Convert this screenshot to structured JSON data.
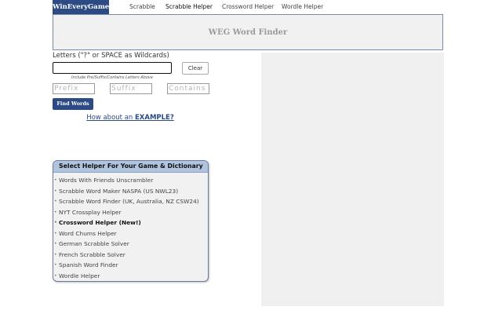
{
  "nav": {
    "brand": "WinEveryGame",
    "links": [
      {
        "label": "Scrabble",
        "active": false
      },
      {
        "label": "Scrabble Helper",
        "active": true
      },
      {
        "label": "Crossword Helper",
        "active": false
      },
      {
        "label": "Wordle Helper",
        "active": false
      }
    ]
  },
  "banner": {
    "title": "WEG Word Finder"
  },
  "form": {
    "letters_label": "Letters (\"?\" or SPACE as Wildcards)",
    "letters_value": "",
    "clear_label": "Clear",
    "hint": "Include Pre/Suffix/Contains Letters Above",
    "prefix_placeholder": "Prefix",
    "suffix_placeholder": "Suffix",
    "contains_placeholder": "Contains",
    "find_label": "Find Words",
    "example_prefix": "How about an ",
    "example_link": "EXAMPLE?"
  },
  "helper": {
    "title": "Select Helper For Your Game & Dictionary",
    "items": [
      {
        "label": "Words With Friends Unscrambler",
        "bold": false
      },
      {
        "label": "Scrabble Word Maker NASPA (US NWL23)",
        "bold": false
      },
      {
        "label": "Scrabble Word Finder (UK, Australia, NZ CSW24)",
        "bold": false
      },
      {
        "label": "NYT Crossplay Helper",
        "bold": false
      },
      {
        "label": "Crossword Helper (New!)",
        "bold": true
      },
      {
        "label": "Word Chums Helper",
        "bold": false
      },
      {
        "label": "German Scrabble Solver",
        "bold": false
      },
      {
        "label": "French Scrabble Solver",
        "bold": false
      },
      {
        "label": "Spanish Word Finder",
        "bold": false
      },
      {
        "label": "Wordle Helper",
        "bold": false
      }
    ]
  },
  "colors": {
    "brand": "#2c4a84",
    "helper_header": "#b0c4de",
    "panel_bg": "#f0f0f0"
  }
}
